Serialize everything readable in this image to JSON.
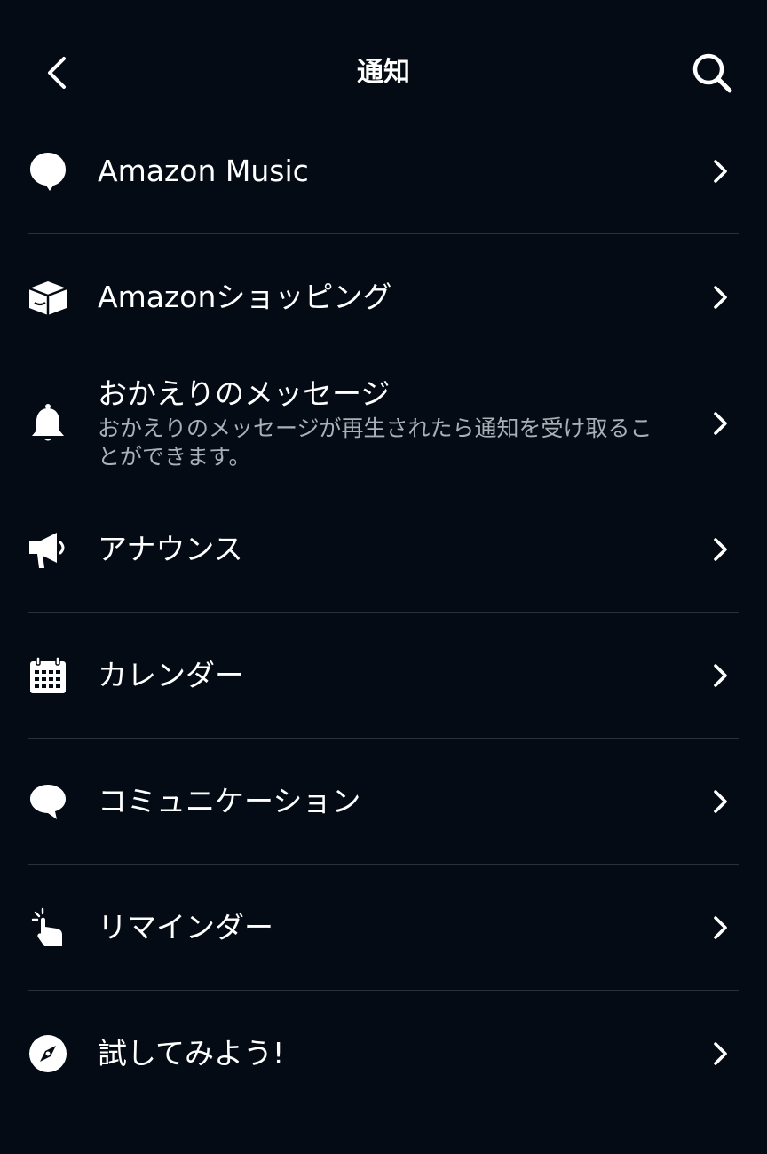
{
  "header": {
    "title": "通知",
    "back_icon": "chevron-left-icon",
    "search_icon": "search-icon"
  },
  "items": [
    {
      "id": "amazon-music",
      "label": "Amazon Music",
      "icon": "speech-bubble-icon"
    },
    {
      "id": "amazon-shopping",
      "label": "Amazonショッピング",
      "icon": "package-icon"
    },
    {
      "id": "welcome-message",
      "label": "おかえりのメッセージ",
      "description": "おかえりのメッセージが再生されたら通知を受け取ることができます。",
      "icon": "bell-icon"
    },
    {
      "id": "announcements",
      "label": "アナウンス",
      "icon": "megaphone-icon"
    },
    {
      "id": "calendar",
      "label": "カレンダー",
      "icon": "calendar-icon"
    },
    {
      "id": "communication",
      "label": "コミュニケーション",
      "icon": "chat-bubble-icon"
    },
    {
      "id": "reminders",
      "label": "リマインダー",
      "icon": "hand-tap-icon"
    },
    {
      "id": "try-it",
      "label": "試してみよう!",
      "icon": "compass-icon"
    }
  ],
  "colors": {
    "background": "#040b14",
    "text": "#ffffff",
    "secondary_text": "#aab0b8",
    "divider": "#2a313a"
  }
}
